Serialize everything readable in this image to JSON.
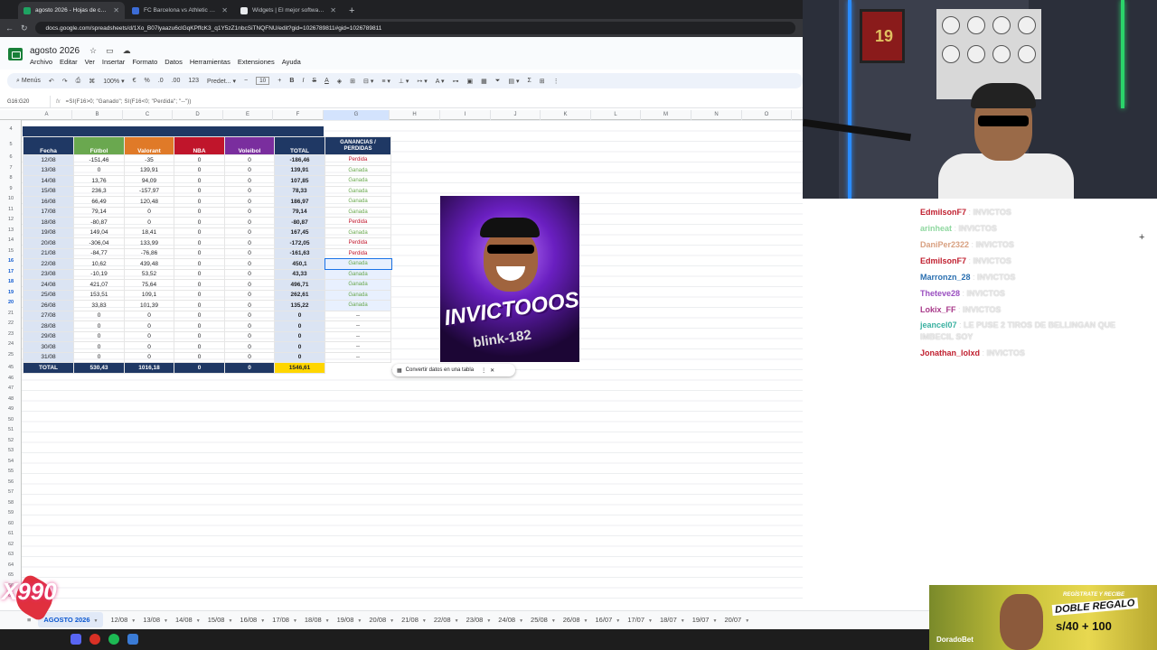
{
  "browser": {
    "tabs": [
      {
        "title": "agosto 2026 - Hojas de cálculo",
        "active": true,
        "color": "#1ea362"
      },
      {
        "title": "FC Barcelona vs Athletic Club",
        "active": false,
        "color": "#3c6cd6"
      },
      {
        "title": "Widgets | El mejor software pa",
        "active": false,
        "color": "#e8eaed"
      }
    ],
    "new_tab": "+",
    "url": "docs.google.com/spreadsheets/d/1Xo_B07lyaazu6clGqKPffcK3_q1Y5zZ1nbcSiTNQFNU/edit?gid=1026789811#gid=1026789811"
  },
  "sheets": {
    "title": "agosto 2026",
    "menu": [
      "Archivo",
      "Editar",
      "Ver",
      "Insertar",
      "Formato",
      "Datos",
      "Herramientas",
      "Extensiones",
      "Ayuda"
    ],
    "toolbar": {
      "menus": "Menús",
      "zoom": "100%",
      "currency": "€",
      "percent": "%",
      "dec_minus": ".0",
      "dec_plus": ".00",
      "fmt123": "123",
      "font": "Predet...",
      "size": "10"
    },
    "namebox": "G16:G20",
    "formula": "=SI(F16>0; \"Ganado\"; SI(F16<0; \"Perdida\"; \"--\"))",
    "columns": [
      "A",
      "B",
      "C",
      "D",
      "E",
      "F",
      "G",
      "H",
      "I",
      "J",
      "K",
      "L",
      "M",
      "N",
      "O"
    ],
    "row_numbers": [
      "4",
      "5",
      "6",
      "7",
      "8",
      "9",
      "10",
      "11",
      "12",
      "13",
      "14",
      "15",
      "16",
      "17",
      "18",
      "19",
      "20",
      "21",
      "22",
      "23",
      "24",
      "25",
      "45",
      "46",
      "47",
      "48",
      "49",
      "50",
      "51",
      "52",
      "53",
      "54",
      "55",
      "56",
      "57",
      "58",
      "59",
      "60",
      "61",
      "62",
      "63",
      "64",
      "65",
      "66",
      "67"
    ],
    "headers": {
      "fecha": "Fecha",
      "futbol": "Fútbol",
      "valorant": "Valorant",
      "nba": "NBA",
      "voleibol": "Voleibol",
      "total": "TOTAL",
      "gp": "GANANCIAS / PERDIDAS"
    },
    "rows": [
      [
        "12/08",
        "-151,46",
        "-35",
        "0",
        "0",
        "-186,46",
        "Perdida"
      ],
      [
        "13/08",
        "0",
        "139,91",
        "0",
        "0",
        "139,91",
        "Ganada"
      ],
      [
        "14/08",
        "13,76",
        "94,09",
        "0",
        "0",
        "107,85",
        "Ganada"
      ],
      [
        "15/08",
        "236,3",
        "-157,97",
        "0",
        "0",
        "78,33",
        "Ganada"
      ],
      [
        "16/08",
        "66,49",
        "120,48",
        "0",
        "0",
        "186,97",
        "Ganada"
      ],
      [
        "17/08",
        "79,14",
        "0",
        "0",
        "0",
        "79,14",
        "Ganada"
      ],
      [
        "18/08",
        "-80,87",
        "0",
        "0",
        "0",
        "-80,87",
        "Perdida"
      ],
      [
        "19/08",
        "149,04",
        "18,41",
        "0",
        "0",
        "167,45",
        "Ganada"
      ],
      [
        "20/08",
        "-306,04",
        "133,99",
        "0",
        "0",
        "-172,05",
        "Perdida"
      ],
      [
        "21/08",
        "-84,77",
        "-76,86",
        "0",
        "0",
        "-161,63",
        "Perdida"
      ],
      [
        "22/08",
        "10,62",
        "439,48",
        "0",
        "0",
        "450,1",
        "Ganada"
      ],
      [
        "23/08",
        "-10,19",
        "53,52",
        "0",
        "0",
        "43,33",
        "Ganada"
      ],
      [
        "24/08",
        "421,07",
        "75,64",
        "0",
        "0",
        "496,71",
        "Ganada"
      ],
      [
        "25/08",
        "153,51",
        "109,1",
        "0",
        "0",
        "262,61",
        "Ganada"
      ],
      [
        "26/08",
        "33,83",
        "101,39",
        "0",
        "0",
        "135,22",
        "Ganada"
      ],
      [
        "27/08",
        "0",
        "0",
        "0",
        "0",
        "0",
        "--"
      ],
      [
        "28/08",
        "0",
        "0",
        "0",
        "0",
        "0",
        "--"
      ],
      [
        "29/08",
        "0",
        "0",
        "0",
        "0",
        "0",
        "--"
      ],
      [
        "30/08",
        "0",
        "0",
        "0",
        "0",
        "0",
        "--"
      ],
      [
        "31/08",
        "0",
        "0",
        "0",
        "0",
        "0",
        "--"
      ]
    ],
    "total_row": [
      "TOTAL",
      "530,43",
      "1016,18",
      "0",
      "0",
      "1546,61"
    ],
    "thumbnail": {
      "big": "INVICTOOOS",
      "small": "blink-182"
    },
    "table_hint": "Convertir datos en una tabla",
    "sheet_tabs": [
      "AGOSTO 2026",
      "12/08",
      "13/08",
      "14/08",
      "15/08",
      "16/08",
      "17/08",
      "18/08",
      "19/08",
      "20/08",
      "21/08",
      "22/08",
      "23/08",
      "24/08",
      "25/08",
      "26/08",
      "16/07",
      "17/07",
      "18/07",
      "19/07",
      "20/07"
    ]
  },
  "overlay": {
    "watermark": "X990",
    "cam_jersey_number": "19",
    "chat": [
      {
        "user": "EdmilsonF7",
        "color": "#c01f2f",
        "text": "INVICTOS"
      },
      {
        "user": "arinheat",
        "color": "#8fd8a0",
        "text": "INVICTOS"
      },
      {
        "user": "DaniPer2322",
        "color": "#d8a080",
        "text": "INVICTOS"
      },
      {
        "user": "EdmilsonF7",
        "color": "#c01f2f",
        "text": "INVICTOS"
      },
      {
        "user": "Marronzn_28",
        "color": "#2a6fb0",
        "text": "INVICTOS"
      },
      {
        "user": "Theteve28",
        "color": "#9a4fc0",
        "text": "INVICTOS"
      },
      {
        "user": "Lokix_FF",
        "color": "#a83a8a",
        "text": "INVICTOS"
      },
      {
        "user": "jeancel07",
        "color": "#3ab0a0",
        "text": "LE PUSE 2 TIROS DE BELLINGAN QUE IMBECIL SOY"
      },
      {
        "user": "Jonathan_lolxd",
        "color": "#c01f2f",
        "text": "INVICTOS"
      }
    ],
    "ad": {
      "brand": "DoradoBet",
      "line1": "REGÍSTRATE Y RECIBE",
      "line2": "DOBLE REGALO",
      "amount": "s/40 + 100"
    }
  }
}
